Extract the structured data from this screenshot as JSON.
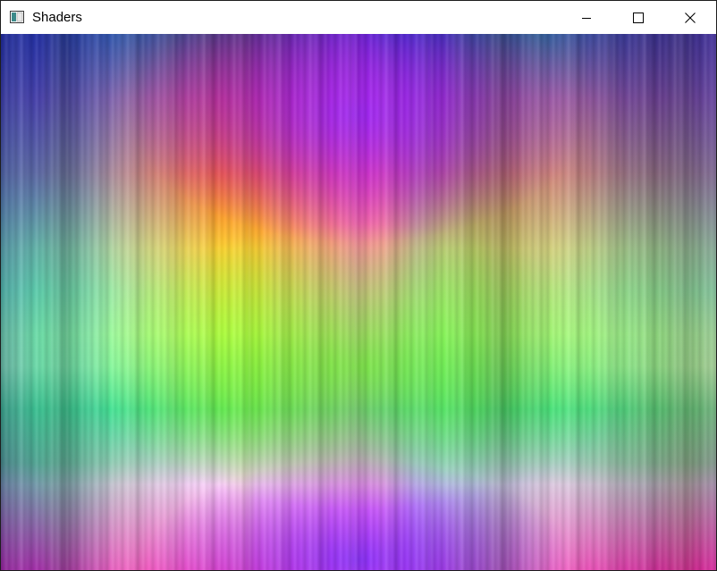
{
  "window": {
    "title": "Shaders",
    "app_icon": "window-app-icon",
    "buttons": {
      "minimize_icon": "minimize-icon",
      "maximize_icon": "maximize-icon",
      "close_icon": "close-icon"
    }
  },
  "canvas": {
    "content": "shader-render-output"
  },
  "colors": {
    "titlebar_bg": "#ffffff",
    "title_text": "#000000",
    "window_border": "#1e1e1e",
    "close_hover": "#e81123"
  }
}
